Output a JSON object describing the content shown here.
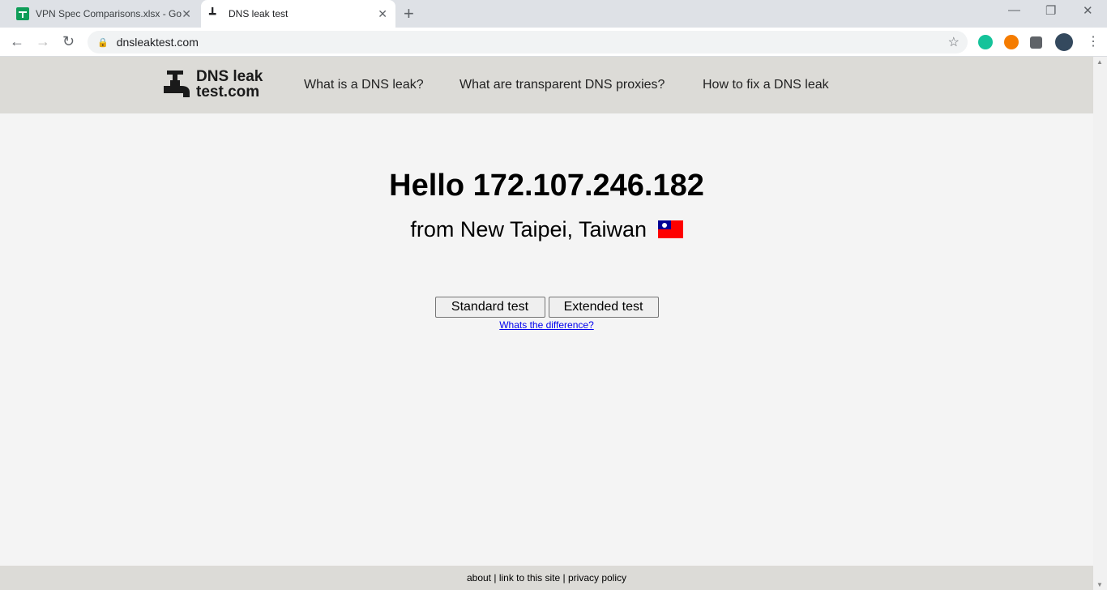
{
  "browser": {
    "tabs": [
      {
        "title": "VPN Spec Comparisons.xlsx - Google Sheets",
        "icon": "google-sheets-icon",
        "active": false
      },
      {
        "title": "DNS leak test",
        "icon": "faucet-icon",
        "active": true
      }
    ],
    "url": "dnsleaktest.com",
    "extensions": [
      "grammarly-icon",
      "fire-extension-icon",
      "puzzle-icon",
      "profile-avatar"
    ]
  },
  "site": {
    "logo": {
      "line1": "DNS leak",
      "line2": "test.com"
    },
    "menu": [
      "What is a DNS leak?",
      "What are transparent DNS proxies?",
      "How to fix a DNS leak"
    ],
    "greeting": "Hello 172.107.246.182",
    "location": "from New Taipei, Taiwan",
    "buttons": {
      "standard": "Standard test",
      "extended": "Extended test"
    },
    "difference_link": "Whats the difference?",
    "footer": {
      "about": "about",
      "link": "link to this site",
      "privacy": "privacy policy"
    }
  }
}
